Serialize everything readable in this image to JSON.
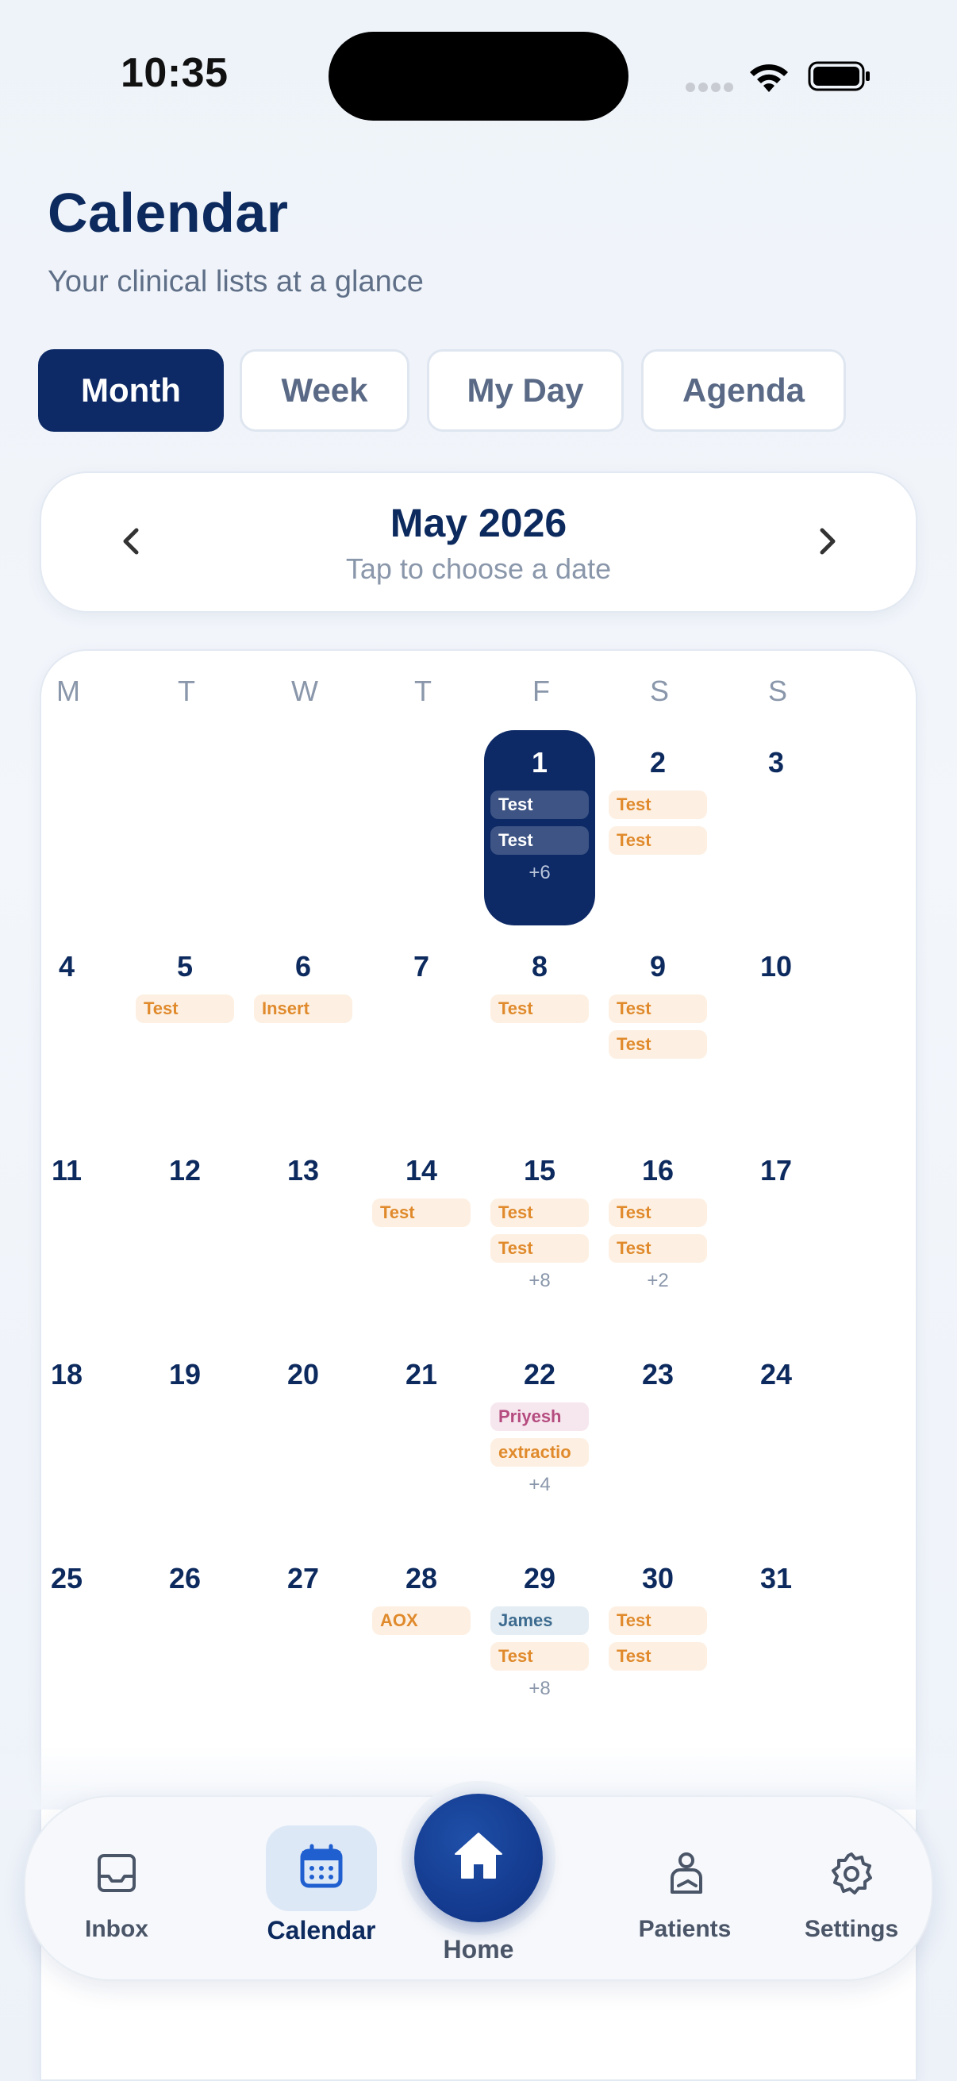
{
  "status": {
    "time": "10:35"
  },
  "header": {
    "title": "Calendar",
    "subtitle": "Your clinical lists at a glance"
  },
  "tabs": [
    {
      "label": "Month",
      "active": true
    },
    {
      "label": "Week",
      "active": false
    },
    {
      "label": "My Day",
      "active": false
    },
    {
      "label": "Agenda",
      "active": false
    }
  ],
  "month_picker": {
    "title": "May 2026",
    "hint": "Tap to choose a date"
  },
  "weekdays": [
    "M",
    "T",
    "W",
    "T",
    "F",
    "S",
    "S"
  ],
  "calendar": {
    "first_weekday_index": 4,
    "days_in_month": 31,
    "selected_day": 1,
    "events": {
      "1": {
        "chips": [
          {
            "text": "Test",
            "color": "onsel"
          },
          {
            "text": "Test",
            "color": "onsel"
          }
        ],
        "more": "+6"
      },
      "2": {
        "chips": [
          {
            "text": "Test",
            "color": "orange"
          },
          {
            "text": "Test",
            "color": "orange"
          }
        ]
      },
      "5": {
        "chips": [
          {
            "text": "Test",
            "color": "orange"
          }
        ]
      },
      "6": {
        "chips": [
          {
            "text": "Insert",
            "color": "orange"
          }
        ]
      },
      "8": {
        "chips": [
          {
            "text": "Test",
            "color": "orange"
          }
        ]
      },
      "9": {
        "chips": [
          {
            "text": "Test",
            "color": "orange"
          },
          {
            "text": "Test",
            "color": "orange"
          }
        ]
      },
      "14": {
        "chips": [
          {
            "text": "Test",
            "color": "orange"
          }
        ]
      },
      "15": {
        "chips": [
          {
            "text": "Test",
            "color": "orange"
          },
          {
            "text": "Test",
            "color": "orange"
          }
        ],
        "more": "+8"
      },
      "16": {
        "chips": [
          {
            "text": "Test",
            "color": "orange"
          },
          {
            "text": "Test",
            "color": "orange"
          }
        ],
        "more": "+2"
      },
      "22": {
        "chips": [
          {
            "text": "Priyesh",
            "color": "pink"
          },
          {
            "text": "extractio",
            "color": "orange"
          }
        ],
        "more": "+4"
      },
      "28": {
        "chips": [
          {
            "text": "AOX",
            "color": "orange"
          }
        ]
      },
      "29": {
        "chips": [
          {
            "text": "James",
            "color": "blue"
          },
          {
            "text": "Test",
            "color": "orange"
          }
        ],
        "more": "+8"
      },
      "30": {
        "chips": [
          {
            "text": "Test",
            "color": "orange"
          },
          {
            "text": "Test",
            "color": "orange"
          }
        ]
      }
    }
  },
  "nav": {
    "inbox": "Inbox",
    "calendar": "Calendar",
    "home": "Home",
    "patients": "Patients",
    "settings": "Settings"
  },
  "colors": {
    "primary": "#0d2a66",
    "chip_orange_bg": "#fdf0e3",
    "chip_orange_text": "#e08a2c",
    "chip_pink_bg": "#f6e6ee",
    "chip_blue_bg": "#e4edf3"
  }
}
